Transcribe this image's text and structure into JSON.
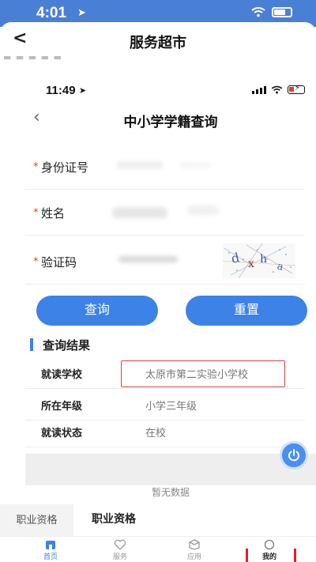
{
  "outer": {
    "status_time": "4:01",
    "header_title": "服务超市",
    "back_icon": "chevron-left-icon"
  },
  "inner": {
    "status_time": "11:49",
    "header_title": "中小学学籍查询",
    "form": {
      "id_label": "身份证号",
      "name_label": "姓名",
      "captcha_label": "验证码",
      "required_mark": "*"
    },
    "buttons": {
      "query": "查询",
      "reset": "重置"
    },
    "result": {
      "title": "查询结果",
      "rows": [
        {
          "key": "就读学校",
          "value": "太原市第二实验小学校"
        },
        {
          "key": "所在年级",
          "value": "小学三年级"
        },
        {
          "key": "就读状态",
          "value": "在校"
        }
      ]
    },
    "empty_text": "暂无数据"
  },
  "bottom": {
    "vocation_left": "职业资格",
    "vocation_center": "职业资格"
  },
  "tabbar": [
    {
      "label": "首页",
      "icon": "home-icon"
    },
    {
      "label": "服务",
      "icon": "heart-icon"
    },
    {
      "label": "应用",
      "icon": "box-icon"
    },
    {
      "label": "我的",
      "icon": "user-icon"
    }
  ],
  "colors": {
    "primary": "#3d82e6",
    "status_bar": "#4a7fd6",
    "highlight": "#d94040",
    "red_mark": "#e41e2b"
  }
}
